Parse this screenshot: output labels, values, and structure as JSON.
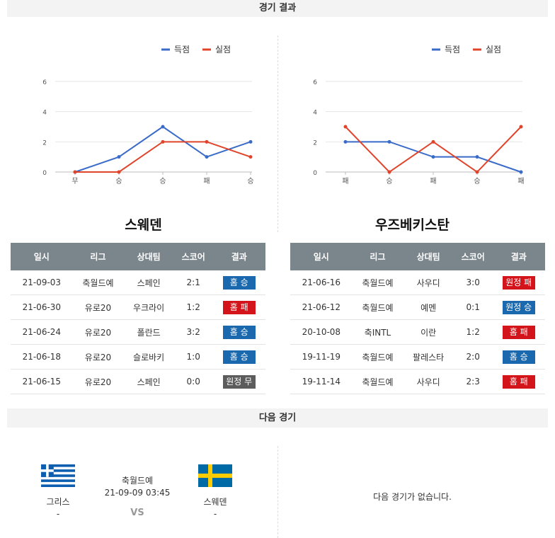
{
  "results_title": "경기 결과",
  "next_title": "다음 경기",
  "legend": {
    "scored": "득점",
    "conceded": "실점"
  },
  "colors": {
    "scored": "#3a6bc9",
    "conceded": "#e0442b",
    "home_win": "#1a68ad",
    "loss": "#d3141b",
    "draw": "#5c5c5c",
    "header": "#7a858c"
  },
  "chart_data": [
    {
      "type": "line",
      "categories": [
        "무",
        "승",
        "승",
        "패",
        "승"
      ],
      "series": [
        {
          "name": "득점",
          "values": [
            0,
            1,
            3,
            1,
            2
          ]
        },
        {
          "name": "실점",
          "values": [
            0,
            0,
            2,
            2,
            1
          ]
        }
      ],
      "ylim": [
        0,
        6
      ],
      "yticks": [
        "0",
        "2",
        "4",
        "6"
      ],
      "legend": "top-right",
      "grid": true
    },
    {
      "type": "line",
      "categories": [
        "패",
        "승",
        "패",
        "승",
        "패"
      ],
      "series": [
        {
          "name": "득점",
          "values": [
            2,
            2,
            1,
            1,
            0
          ]
        },
        {
          "name": "실점",
          "values": [
            3,
            0,
            2,
            0,
            3
          ]
        }
      ],
      "ylim": [
        0,
        6
      ],
      "yticks": [
        "0",
        "2",
        "4",
        "6"
      ],
      "legend": "top-right",
      "grid": true
    }
  ],
  "teams": [
    {
      "name": "스웨덴",
      "headers": [
        "일시",
        "리그",
        "상대팀",
        "스코어",
        "결과"
      ],
      "rows": [
        {
          "date": "21-09-03",
          "league": "축월드예",
          "opponent": "스페인",
          "score": "2:1",
          "result": "홈 승",
          "kind": "home-win"
        },
        {
          "date": "21-06-30",
          "league": "유로20",
          "opponent": "우크라이",
          "score": "1:2",
          "result": "홈 패",
          "kind": "home-lose"
        },
        {
          "date": "21-06-24",
          "league": "유로20",
          "opponent": "폴란드",
          "score": "3:2",
          "result": "홈 승",
          "kind": "home-win"
        },
        {
          "date": "21-06-18",
          "league": "유로20",
          "opponent": "슬로바키",
          "score": "1:0",
          "result": "홈 승",
          "kind": "home-win"
        },
        {
          "date": "21-06-15",
          "league": "유로20",
          "opponent": "스페인",
          "score": "0:0",
          "result": "원정 무",
          "kind": "away-draw"
        }
      ]
    },
    {
      "name": "우즈베키스탄",
      "headers": [
        "일시",
        "리그",
        "상대팀",
        "스코어",
        "결과"
      ],
      "rows": [
        {
          "date": "21-06-16",
          "league": "축월드예",
          "opponent": "사우디",
          "score": "3:0",
          "result": "원정 패",
          "kind": "away-lose"
        },
        {
          "date": "21-06-12",
          "league": "축월드예",
          "opponent": "예멘",
          "score": "0:1",
          "result": "원정 승",
          "kind": "away-win"
        },
        {
          "date": "20-10-08",
          "league": "축INTL",
          "opponent": "이란",
          "score": "1:2",
          "result": "홈 패",
          "kind": "home-lose"
        },
        {
          "date": "19-11-19",
          "league": "축월드예",
          "opponent": "팔레스타",
          "score": "2:0",
          "result": "홈 승",
          "kind": "home-win"
        },
        {
          "date": "19-11-14",
          "league": "축월드예",
          "opponent": "사우디",
          "score": "2:3",
          "result": "홈 패",
          "kind": "home-lose"
        }
      ]
    }
  ],
  "next_match": {
    "home": {
      "name": "그리스",
      "rank": "-",
      "flag": "greece-flag"
    },
    "away": {
      "name": "스웨덴",
      "rank": "-",
      "flag": "sweden-flag"
    },
    "league": "축월드예",
    "datetime": "21-09-09 03:45",
    "vs": "VS",
    "none_message": "다음 경기가 없습니다."
  }
}
